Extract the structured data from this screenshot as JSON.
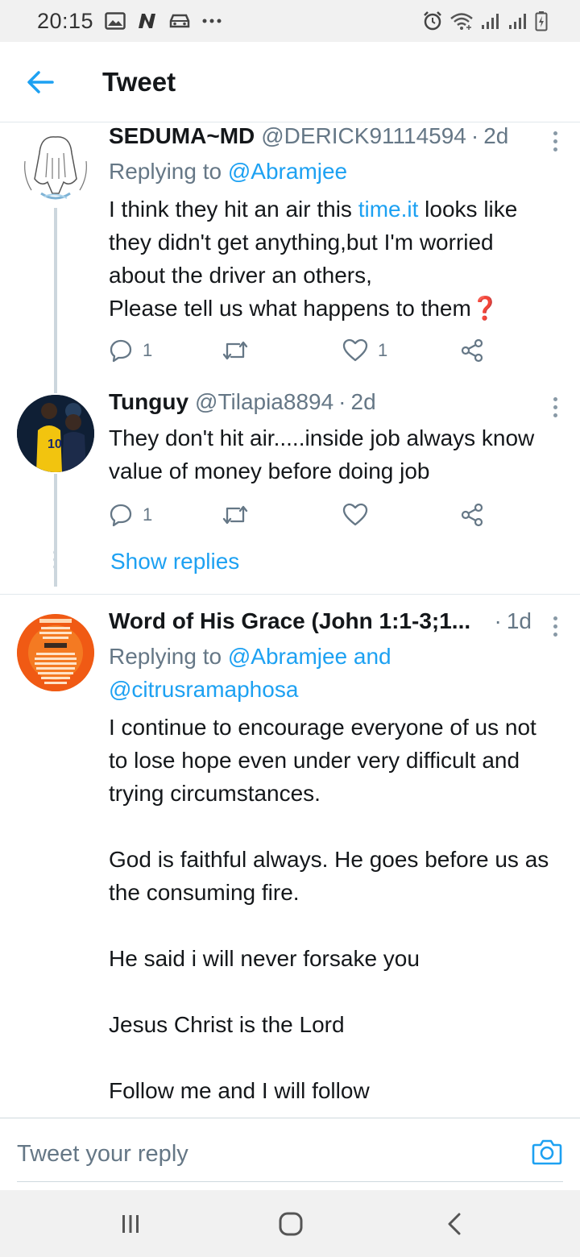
{
  "status_bar": {
    "time": "20:15",
    "left_icons": [
      "gallery-icon",
      "n-notification-icon",
      "car-icon",
      "more-dots-icon"
    ],
    "right_icons": [
      "alarm-icon",
      "wifi-icon",
      "signal-icon",
      "signal-icon",
      "battery-charging-icon"
    ]
  },
  "header": {
    "back_icon": "arrow-left-icon",
    "title": "Tweet"
  },
  "tweets": [
    {
      "name": "SEDUMA~MD",
      "handle": "@DERICK91114594",
      "time": "2d",
      "reply_prefix": "Replying to ",
      "reply_to": "@Abramjee",
      "text_before_link": "I think they hit an air this ",
      "text_link": "time.it",
      "text_after_link": " looks like they didn't get anything,but I'm worried about the driver an others,\nPlease tell us what happens to them",
      "emoji": "❓",
      "reply_count": "1",
      "retweet_count": "",
      "like_count": "1"
    },
    {
      "name": "Tunguy",
      "handle": "@Tilapia8894",
      "time": "2d",
      "text": "They don't hit air.....inside job always know value of money before doing job",
      "reply_count": "1",
      "retweet_count": "",
      "like_count": ""
    },
    {
      "name": "Word of His Grace (John 1:1-3;1...",
      "handle": "",
      "time": "1d",
      "reply_prefix": "Replying to ",
      "reply_to": "@Abramjee and @citrusramaphosa",
      "text": "I continue to encourage everyone of us not to lose hope even under very difficult and trying circumstances.\n\nGod is faithful always. He goes before us as the consuming fire.\n\nHe said i will never forsake you\n\nJesus Christ is the Lord\n\nFollow me and I will follow"
    }
  ],
  "show_replies": "Show replies",
  "reply_bar": {
    "placeholder": "Tweet your reply",
    "camera_icon": "camera-icon"
  },
  "nav_bar": {
    "icons": [
      "recent-apps-icon",
      "home-icon",
      "back-icon"
    ]
  },
  "colors": {
    "accent": "#1da1f2",
    "secondary_text": "#657786",
    "primary_text": "#14171a",
    "divider": "#e1e8ed"
  }
}
